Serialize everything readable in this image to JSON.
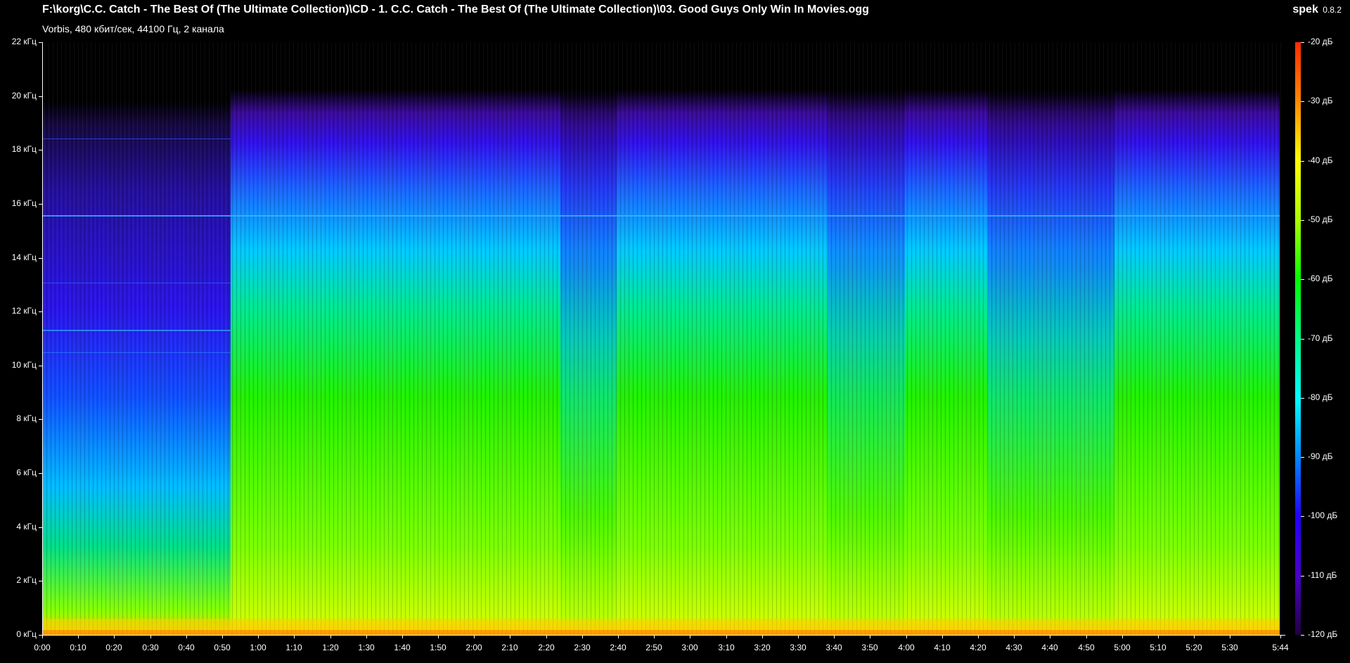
{
  "header": {
    "file_path": "F:\\korg\\C.C. Catch - The Best Of (The Ultimate Collection)\\CD - 1. C.C. Catch - The Best Of (The Ultimate Collection)\\03. Good Guys Only Win In Movies.ogg",
    "format_info": "Vorbis, 480 кбит/сек, 44100 Гц, 2 канала",
    "app_name": "spek",
    "app_version": "0.8.2"
  },
  "freq_axis": {
    "labels": [
      "22 кГц",
      "20 кГц",
      "18 кГц",
      "16 кГц",
      "14 кГц",
      "12 кГц",
      "10 кГц",
      "8 кГц",
      "6 кГц",
      "4 кГц",
      "2 кГц",
      "0 кГц"
    ],
    "values_khz": [
      22,
      20,
      18,
      16,
      14,
      12,
      10,
      8,
      6,
      4,
      2,
      0
    ]
  },
  "time_axis": {
    "labels": [
      "0:00",
      "0:10",
      "0:20",
      "0:30",
      "0:40",
      "0:50",
      "1:00",
      "1:10",
      "1:20",
      "1:30",
      "1:40",
      "1:50",
      "2:00",
      "2:10",
      "2:20",
      "2:30",
      "2:40",
      "2:50",
      "3:00",
      "3:10",
      "3:20",
      "3:30",
      "3:40",
      "3:50",
      "4:00",
      "4:10",
      "4:20",
      "4:30",
      "4:40",
      "4:50",
      "5:00",
      "5:10",
      "5:20",
      "5:30",
      "5:44"
    ],
    "seconds": [
      0,
      10,
      20,
      30,
      40,
      50,
      60,
      70,
      80,
      90,
      100,
      110,
      120,
      130,
      140,
      150,
      160,
      170,
      180,
      190,
      200,
      210,
      220,
      230,
      240,
      250,
      260,
      270,
      280,
      290,
      300,
      310,
      320,
      330,
      344
    ],
    "duration_seconds": 344
  },
  "db_scale": {
    "labels": [
      "-20 дБ",
      "-30 дБ",
      "-40 дБ",
      "-50 дБ",
      "-60 дБ",
      "-70 дБ",
      "-80 дБ",
      "-90 дБ",
      "-100 дБ",
      "-110 дБ",
      "-120 дБ"
    ],
    "values": [
      -20,
      -30,
      -40,
      -50,
      -60,
      -70,
      -80,
      -90,
      -100,
      -110,
      -120
    ]
  },
  "colors": {
    "background": "#000000",
    "text": "#ffffff"
  }
}
